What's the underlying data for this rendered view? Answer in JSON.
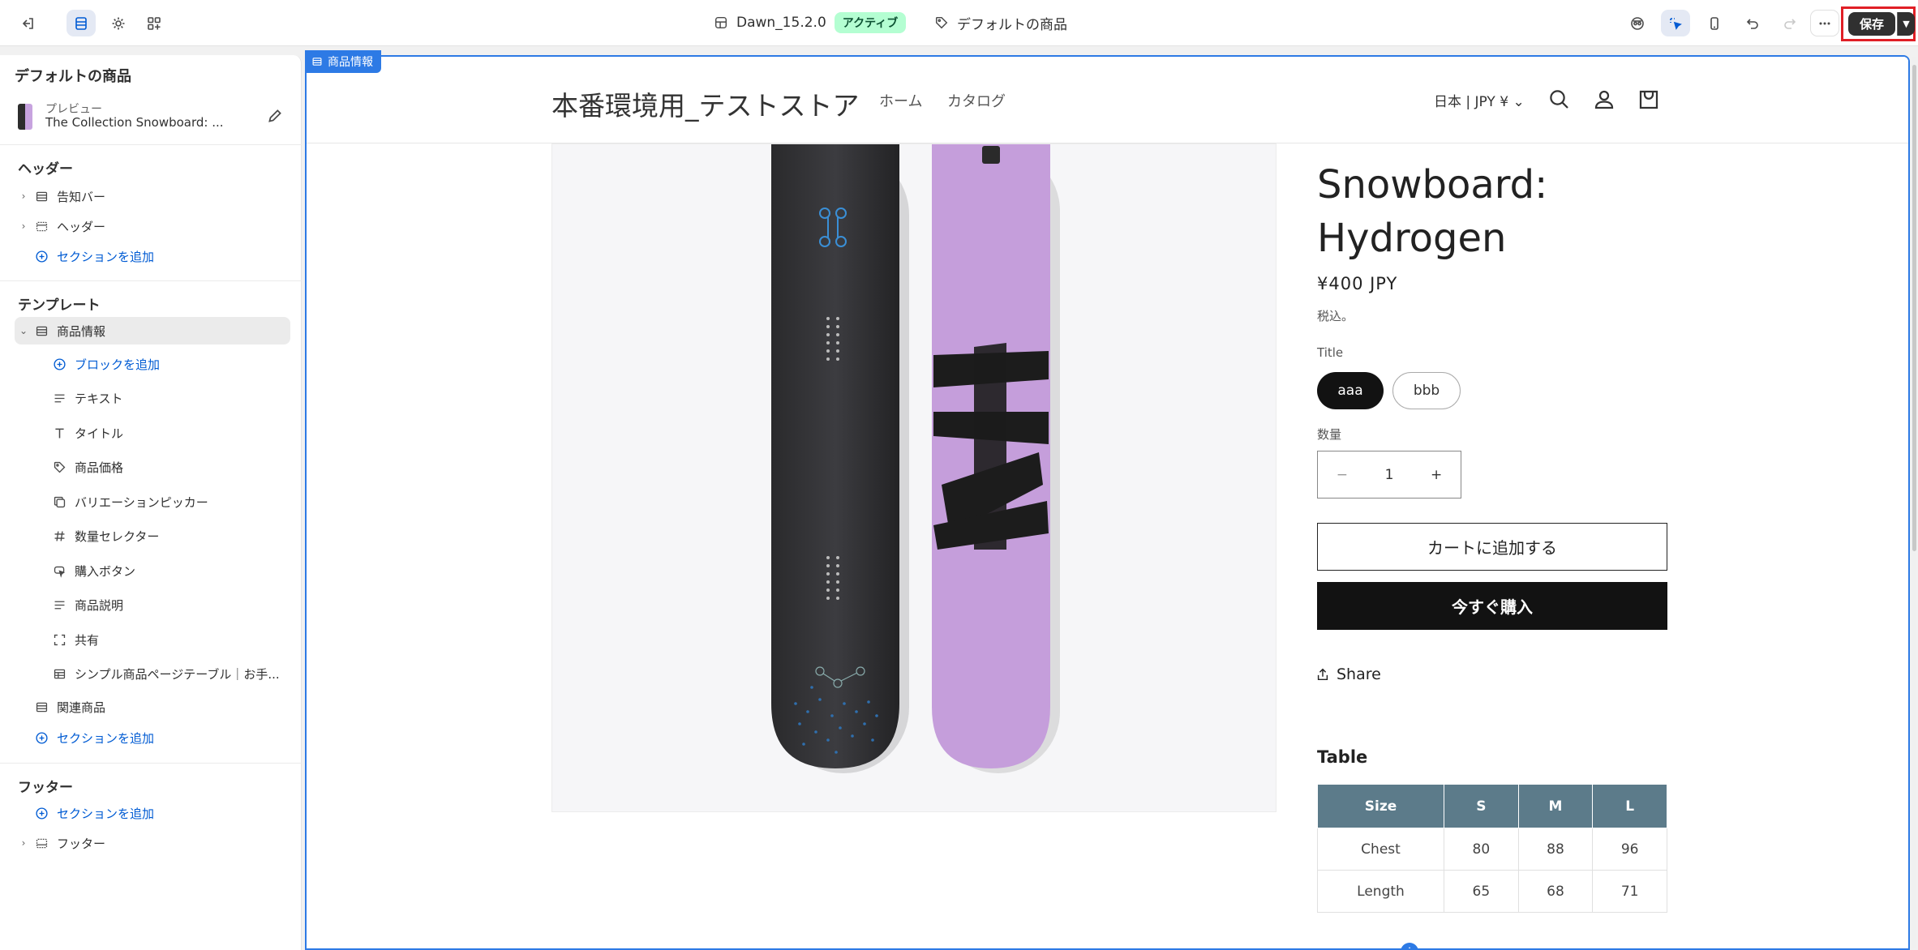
{
  "topbar": {
    "theme_name": "Dawn_15.2.0",
    "theme_status": "アクティブ",
    "template_name": "デフォルトの商品",
    "save_label": "保存",
    "icons": [
      "exit-icon",
      "sections-icon",
      "settings-icon",
      "apps-icon",
      "customer-view-icon",
      "inspector-icon",
      "mobile-icon",
      "undo-icon",
      "redo-icon",
      "more-icon"
    ]
  },
  "sidebar": {
    "title": "デフォルトの商品",
    "preview_label": "プレビュー",
    "preview_product": "The Collection Snowboard: ...",
    "header_section": "ヘッダー",
    "header_items": [
      {
        "label": "告知バー"
      },
      {
        "label": "ヘッダー"
      }
    ],
    "add_section": "セクションを追加",
    "template_section": "テンプレート",
    "product_info": "商品情報",
    "add_block": "ブロックを追加",
    "blocks": [
      {
        "label": "テキスト",
        "icon": "text-icon"
      },
      {
        "label": "タイトル",
        "icon": "title-icon"
      },
      {
        "label": "商品価格",
        "icon": "price-tag-icon"
      },
      {
        "label": "バリエーションピッカー",
        "icon": "variant-icon"
      },
      {
        "label": "数量セレクター",
        "icon": "hash-icon"
      },
      {
        "label": "購入ボタン",
        "icon": "cursor-icon"
      },
      {
        "label": "商品説明",
        "icon": "text-icon"
      },
      {
        "label": "共有",
        "icon": "share-frame-icon"
      },
      {
        "label": "シンプル商品ページテーブル｜お手...",
        "icon": "table-icon"
      }
    ],
    "related": "関連商品",
    "footer_section": "フッター",
    "footer_item": "フッター"
  },
  "store": {
    "section_label": "商品情報",
    "name": "本番環境用_テストストア",
    "nav": [
      "ホーム",
      "カタログ"
    ],
    "locale": "日本 | JPY ¥",
    "product_title": "Snowboard: Hydrogen",
    "price": "¥400 JPY",
    "tax": "税込。",
    "option_label": "Title",
    "options": [
      "aaa",
      "bbb"
    ],
    "selected_option": "aaa",
    "quantity_label": "数量",
    "quantity": "1",
    "add_to_cart": "カートに追加する",
    "buy_now": "今すぐ購入",
    "share": "Share",
    "table_title": "Table",
    "table": {
      "headers": [
        "Size",
        "S",
        "M",
        "L"
      ],
      "rows": [
        [
          "Chest",
          "80",
          "88",
          "96"
        ],
        [
          "Length",
          "65",
          "68",
          "71"
        ]
      ]
    }
  }
}
